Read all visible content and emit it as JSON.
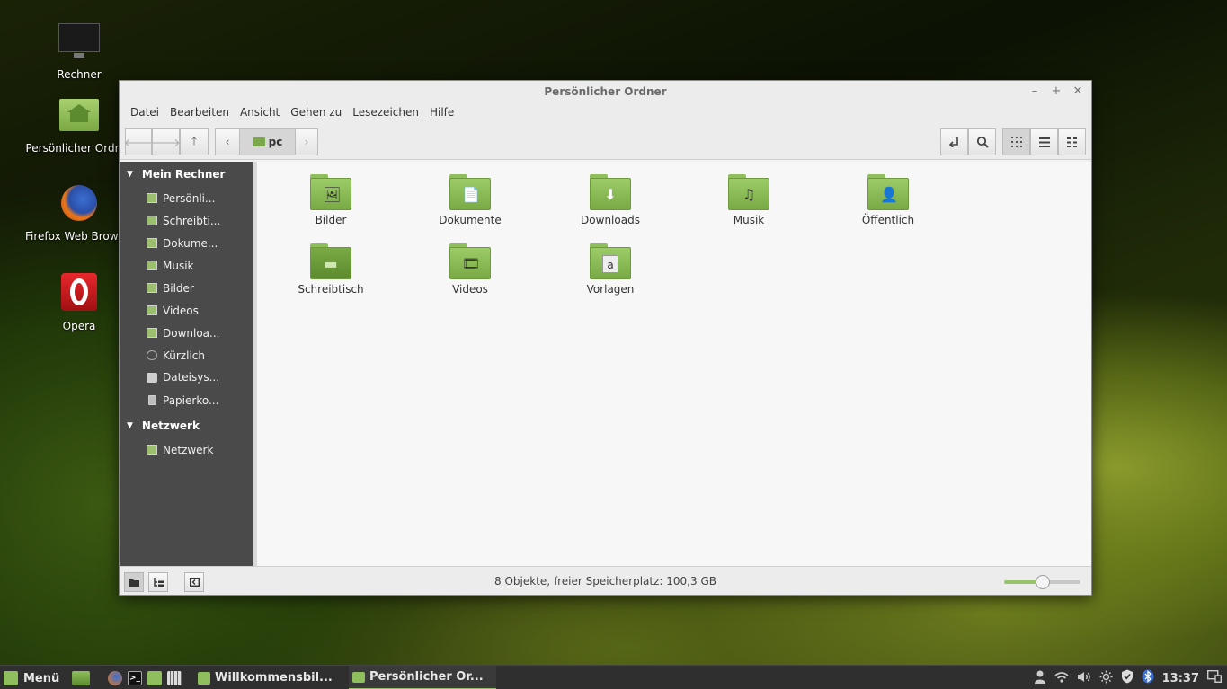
{
  "desktop": {
    "icons": [
      {
        "label": "Rechner",
        "icon": "monitor-icon"
      },
      {
        "label": "Persönlicher Ordner",
        "icon": "home-folder-icon"
      },
      {
        "label": "Firefox Web Browser",
        "icon": "firefox-icon"
      },
      {
        "label": "Opera",
        "icon": "opera-icon"
      }
    ]
  },
  "window": {
    "title": "Persönlicher Ordner",
    "controls": {
      "minimize": "–",
      "maximize": "+",
      "close": "✕"
    },
    "menu": [
      "Datei",
      "Bearbeiten",
      "Ansicht",
      "Gehen zu",
      "Lesezeichen",
      "Hilfe"
    ],
    "toolbar": {
      "back": "🡐",
      "forward": "🡒",
      "up": "🡑",
      "crumb_left": "‹",
      "crumb_right": "›",
      "current_folder": "pc"
    },
    "sidebar": {
      "sections": [
        {
          "title": "Mein Rechner",
          "items": [
            "Persönli...",
            "Schreibti...",
            "Dokume...",
            "Musik",
            "Bilder",
            "Videos",
            "Downloa...",
            "Kürzlich",
            "Dateisys...",
            "Papierko..."
          ]
        },
        {
          "title": "Netzwerk",
          "items": [
            "Netzwerk"
          ]
        }
      ]
    },
    "files": [
      {
        "name": "Bilder",
        "emblem": "🖼"
      },
      {
        "name": "Dokumente",
        "emblem": "📄"
      },
      {
        "name": "Downloads",
        "emblem": "⬇"
      },
      {
        "name": "Musik",
        "emblem": "♫"
      },
      {
        "name": "Öffentlich",
        "emblem": "👤"
      },
      {
        "name": "Schreibtisch",
        "emblem": "▬"
      },
      {
        "name": "Videos",
        "emblem": "🎞"
      },
      {
        "name": "Vorlagen",
        "emblem": "a"
      }
    ],
    "status": "8 Objekte, freier Speicherplatz: 100,3 GB",
    "zoom_level": 0.5
  },
  "taskbar": {
    "menu_label": "Menü",
    "tasks": [
      "Willkommensbil...",
      "Persönlicher Or..."
    ],
    "clock": "13:37"
  },
  "colors": {
    "accent": "#8fbf5c",
    "sidebar_bg": "#4a4a4a",
    "taskbar_bg": "#2f2f2f"
  }
}
